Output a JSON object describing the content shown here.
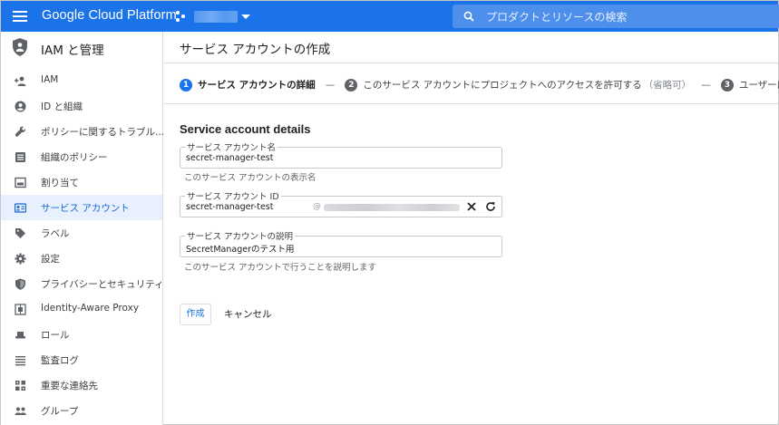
{
  "topbar": {
    "brand": "Google Cloud Platform",
    "search_placeholder": "プロダクトとリソースの検索"
  },
  "sidebar": {
    "title": "IAM と管理",
    "items": [
      {
        "label": "IAM",
        "icon": "person-add-icon"
      },
      {
        "label": "ID と組織",
        "icon": "account-circle-icon"
      },
      {
        "label": "ポリシーに関するトラブル...",
        "icon": "wrench-icon"
      },
      {
        "label": "組織のポリシー",
        "icon": "list-alt-icon"
      },
      {
        "label": "割り当て",
        "icon": "quota-icon"
      },
      {
        "label": "サービス アカウント",
        "icon": "service-account-icon",
        "active": true
      },
      {
        "label": "ラベル",
        "icon": "label-icon"
      },
      {
        "label": "設定",
        "icon": "gear-icon"
      },
      {
        "label": "プライバシーとセキュリティ",
        "icon": "shield-icon"
      },
      {
        "label": "Identity-Aware Proxy",
        "icon": "iap-icon"
      },
      {
        "label": "ロール",
        "icon": "hat-icon"
      },
      {
        "label": "監査ログ",
        "icon": "audit-list-icon"
      },
      {
        "label": "重要な連絡先",
        "icon": "contacts-icon"
      },
      {
        "label": "グループ",
        "icon": "group-icon"
      }
    ]
  },
  "main": {
    "page_title": "サービス アカウントの作成",
    "steps": [
      {
        "num": "1",
        "label": "サービス アカウントの詳細"
      },
      {
        "num": "2",
        "label": "このサービス アカウントにプロジェクトへのアクセスを許可する",
        "optional": "（省略可）"
      },
      {
        "num": "3",
        "label": "ユーザーにこ"
      }
    ],
    "step_separator": "—",
    "section_title": "Service account details",
    "fields": {
      "name": {
        "label": "サービス アカウント名",
        "value": "secret-manager-test",
        "hint": "このサービス アカウントの表示名"
      },
      "id": {
        "label": "サービス アカウント ID",
        "value": "secret-manager-test",
        "suffix_prefix": "@"
      },
      "description": {
        "label": "サービス アカウントの説明",
        "value": "SecretManagerのテスト用",
        "hint": "このサービス アカウントで行うことを説明します"
      }
    },
    "buttons": {
      "create": "作成",
      "cancel": "キャンセル"
    }
  },
  "colors": {
    "accent": "#1a73e8",
    "active_bg": "#e8f0fe",
    "active_text": "#1967d2"
  }
}
